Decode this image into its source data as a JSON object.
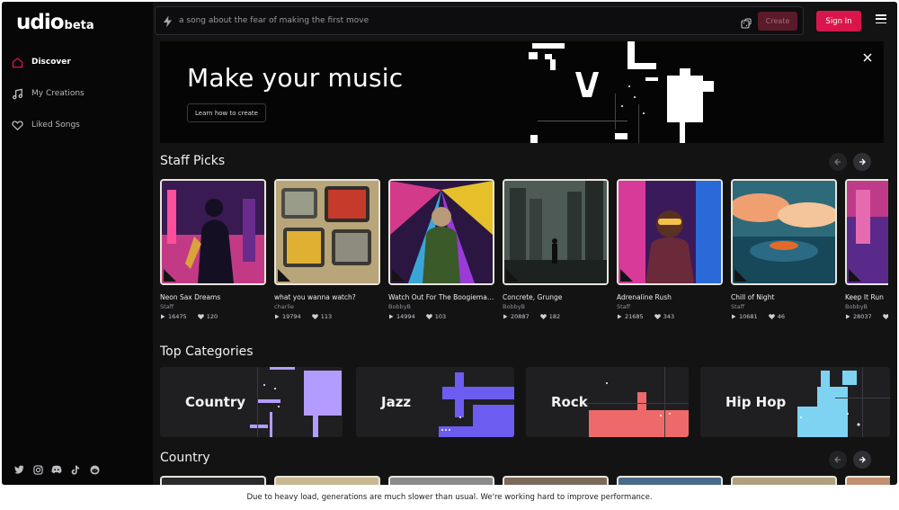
{
  "app": {
    "logo": "udio",
    "logo_badge": "beta"
  },
  "sidebar": {
    "items": [
      {
        "label": "Discover",
        "icon": "home-icon",
        "active": true
      },
      {
        "label": "My Creations",
        "icon": "music-note-icon",
        "active": false
      },
      {
        "label": "Liked Songs",
        "icon": "heart-icon",
        "active": false
      }
    ],
    "socials": [
      "twitter-icon",
      "instagram-icon",
      "discord-icon",
      "tiktok-icon",
      "reddit-icon"
    ]
  },
  "topbar": {
    "search_placeholder": "a song about the fear of making the first move",
    "create_label": "Create",
    "signin_label": "Sign In"
  },
  "hero": {
    "title": "Make your music",
    "button_label": "Learn how to create"
  },
  "staff_picks": {
    "title": "Staff Picks",
    "cards": [
      {
        "name": "Neon Sax Dreams",
        "artist": "Staff",
        "plays": "16475",
        "likes": "120"
      },
      {
        "name": "what you wanna watch?",
        "artist": "charlie",
        "plays": "19794",
        "likes": "113"
      },
      {
        "name": "Watch Out For The Boogieman, ...",
        "artist": "BobbyB",
        "plays": "14994",
        "likes": "103"
      },
      {
        "name": "Concrete, Grunge",
        "artist": "BobbyB",
        "plays": "20887",
        "likes": "182"
      },
      {
        "name": "Adrenaline Rush",
        "artist": "Staff",
        "plays": "21685",
        "likes": "343"
      },
      {
        "name": "Chill of Night",
        "artist": "Staff",
        "plays": "10681",
        "likes": "46"
      },
      {
        "name": "Keep It Run",
        "artist": "BobbyB",
        "plays": "28037",
        "likes": "65"
      }
    ]
  },
  "top_categories": {
    "title": "Top Categories",
    "items": [
      {
        "label": "Country",
        "color": "#b39cff"
      },
      {
        "label": "Jazz",
        "color": "#6c5cf0"
      },
      {
        "label": "Rock",
        "color": "#ee6a6a"
      },
      {
        "label": "Hip Hop",
        "color": "#7fd3f2"
      }
    ]
  },
  "country": {
    "title": "Country"
  },
  "notice": "Due to heavy load, generations are much slower than usual. We're working hard to improve performance.",
  "colors": {
    "accent": "#d9164b",
    "background": "#131314",
    "sidebar": "#070708"
  }
}
